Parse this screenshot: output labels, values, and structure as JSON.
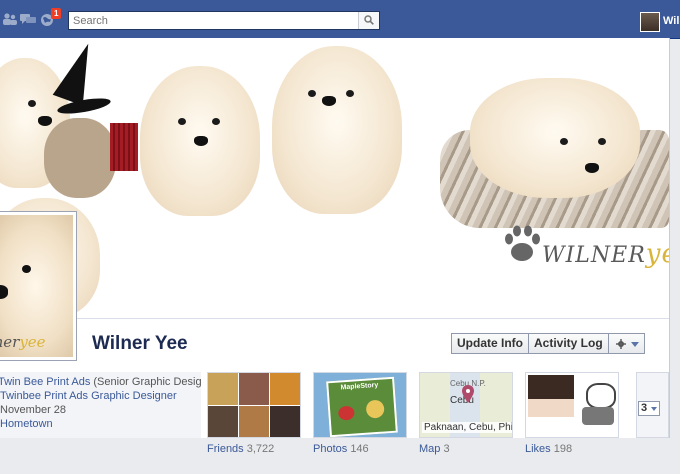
{
  "topbar": {
    "notification_count": "1",
    "search": {
      "placeholder": "Search",
      "value": ""
    },
    "user_short": "Wil",
    "bg_color": "#3b5998",
    "icons": [
      "friend-requests-icon",
      "messages-icon",
      "notifications-globe-icon",
      "search-icon"
    ]
  },
  "profile": {
    "name": "Wilner Yee",
    "cover_watermark": {
      "main": "WILNER",
      "accent": "yee"
    },
    "profile_watermark": {
      "main": "ilner",
      "accent": "yee"
    }
  },
  "actions": {
    "update_info": "Update Info",
    "activity_log": "Activity Log"
  },
  "info_lines": [
    {
      "link": "Twin Bee Print Ads",
      "rest": " (Senior Graphic Designer)"
    },
    {
      "link": "Twinbee Print Ads Graphic Designer"
    },
    {
      "text": "November 28"
    },
    {
      "link": "Hometown"
    }
  ],
  "apps": [
    {
      "label": "Friends",
      "count": "3,722"
    },
    {
      "label": "Photos",
      "count": "146",
      "thumb_caption": "MapleStory"
    },
    {
      "label": "Map",
      "count": "3",
      "map_caption": "Paknaan, Cebu, Philippines",
      "city": "Cebu",
      "region": "Cebu N.P."
    },
    {
      "label": "Likes",
      "count": "198"
    }
  ],
  "more_apps_count": "3"
}
